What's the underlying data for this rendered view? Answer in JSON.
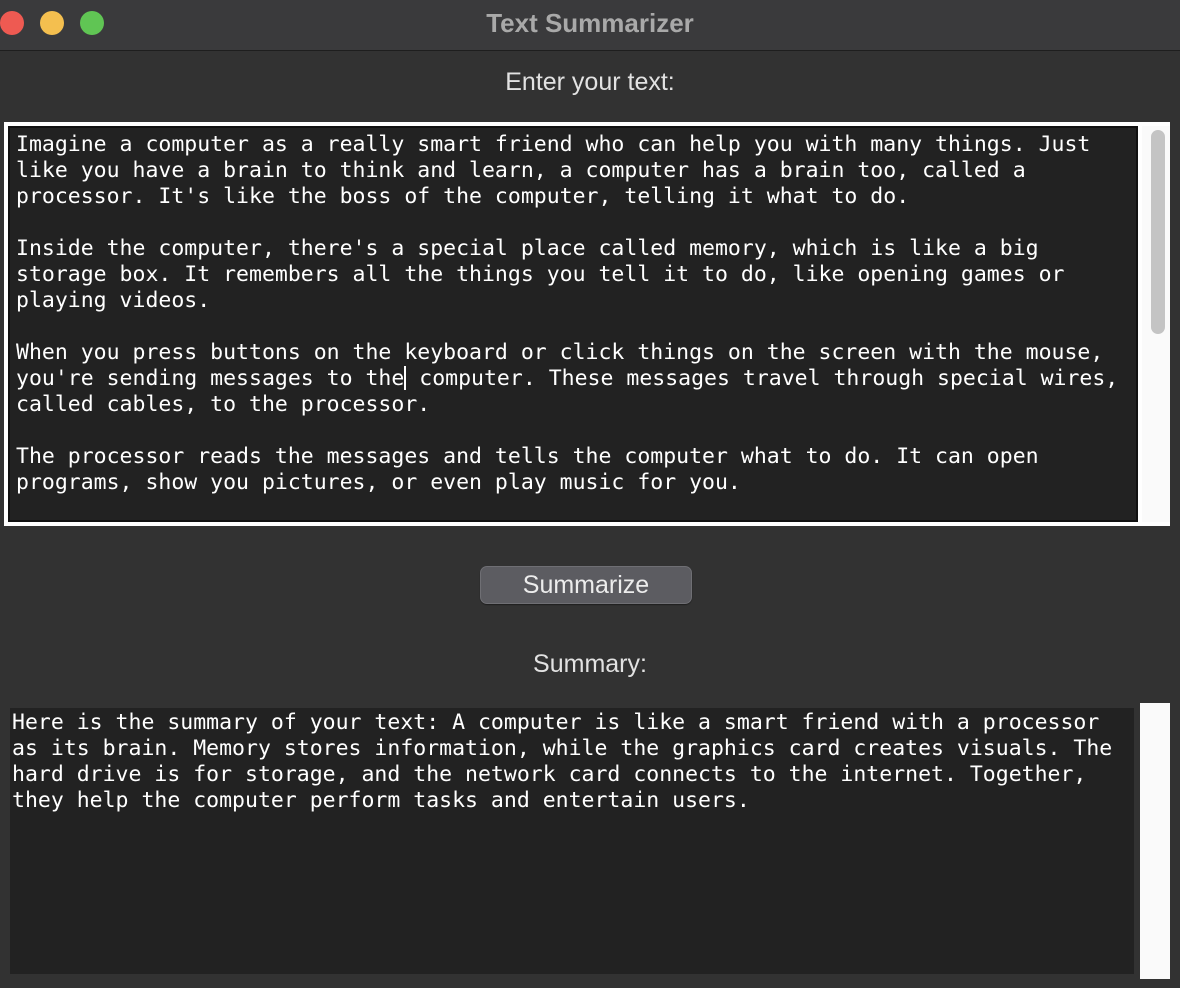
{
  "window": {
    "title": "Text Summarizer"
  },
  "input": {
    "label": "Enter your text:",
    "paragraphs": [
      "Imagine a computer as a really smart friend who can help you with many things. Just like you have a brain to think and learn, a computer has a brain too, called a processor. It's like the boss of the computer, telling it what to do.",
      "Inside the computer, there's a special place called memory, which is like a big storage box. It remembers all the things you tell it to do, like opening games or playing videos.",
      "When you press buttons on the keyboard or click things on the screen with the mouse, you're sending messages to the",
      " computer. These messages travel through special wires, called cables, to the processor.",
      "The processor reads the messages and tells the computer what to do. It can open programs, show you pictures, or even play music for you."
    ]
  },
  "actions": {
    "summarize_label": "Summarize"
  },
  "summary": {
    "label": "Summary:",
    "text": "Here is the summary of your text: A computer is like a smart friend with a processor as its brain. Memory stores information, while the graphics card creates visuals. The hard drive is for storage, and the network card connects to the internet. Together, they help the computer perform tasks and entertain users."
  },
  "colors": {
    "window_bg": "#323232",
    "text_area_bg": "#222222",
    "button_bg": "#5c5c61",
    "close": "#ee5a52",
    "minimize": "#f4bf4f",
    "maximize": "#60c554"
  },
  "icons": [
    "close-window-icon",
    "minimize-window-icon",
    "maximize-window-icon"
  ]
}
